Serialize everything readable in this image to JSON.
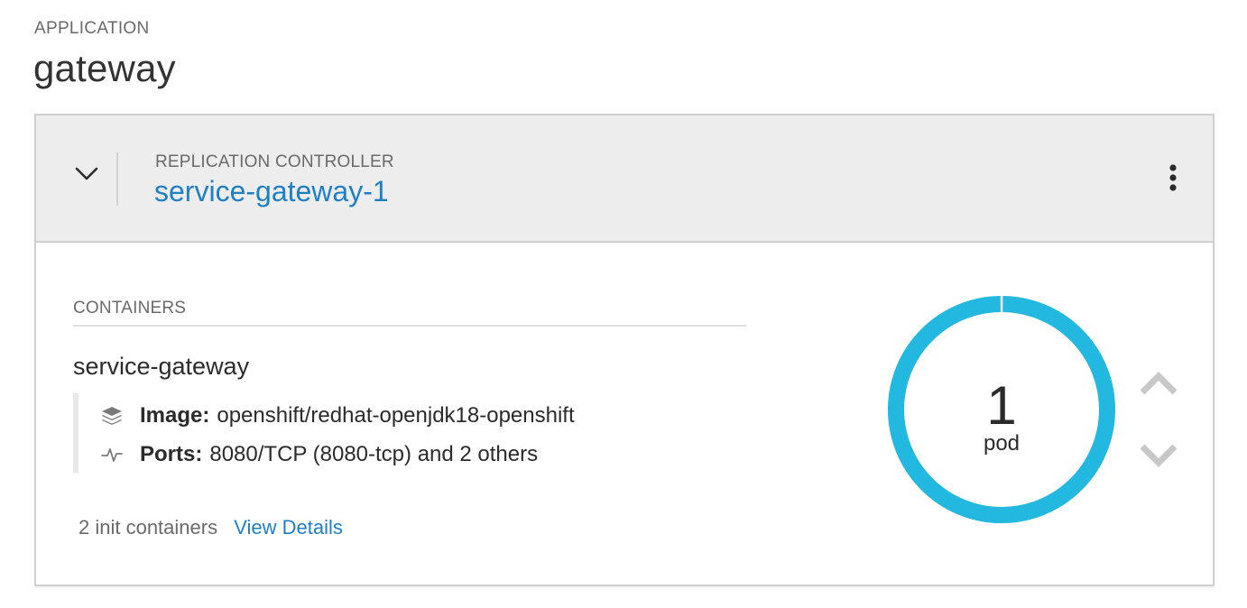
{
  "app": {
    "eyebrow": "APPLICATION",
    "title": "gateway"
  },
  "replication_controller": {
    "eyebrow": "REPLICATION CONTROLLER",
    "name": "service-gateway-1"
  },
  "containers": {
    "section_label": "CONTAINERS",
    "items": [
      {
        "name": "service-gateway",
        "image_label": "Image:",
        "image_value": "openshift/redhat-openjdk18-openshift",
        "ports_label": "Ports:",
        "ports_value": "8080/TCP (8080-tcp) and 2 others"
      }
    ],
    "init_text": "2 init containers",
    "view_details_label": "View Details"
  },
  "pods": {
    "count": "1",
    "unit": "pod",
    "ready_fraction": 1.0
  },
  "icons": {
    "collapse": "chevron-down-icon",
    "kebab": "kebab-menu-icon",
    "image": "layers-icon",
    "ports": "pulse-icon",
    "scale_up": "chevron-up-icon",
    "scale_down": "chevron-down-icon"
  },
  "colors": {
    "link": "#1f7fc5",
    "donut": "#22b8df",
    "header_bg": "#ededed",
    "scale_arrow": "#c8c8c8"
  }
}
